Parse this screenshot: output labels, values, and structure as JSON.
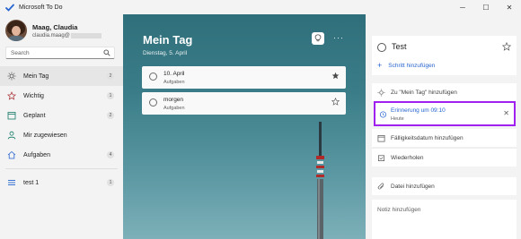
{
  "app": {
    "title": "Microsoft To Do"
  },
  "window_controls": {
    "minimize": "─",
    "maximize": "☐",
    "close": "✕"
  },
  "profile": {
    "name": "Maag, Claudia",
    "email": "claudia.maag@"
  },
  "search": {
    "placeholder": "Search"
  },
  "nav": [
    {
      "label": "Mein Tag",
      "count": "2",
      "icon": "sun-icon",
      "active": true
    },
    {
      "label": "Wichtig",
      "count": "1",
      "icon": "star-icon"
    },
    {
      "label": "Geplant",
      "count": "2",
      "icon": "calendar-icon"
    },
    {
      "label": "Mir zugewiesen",
      "count": "",
      "icon": "person-icon"
    },
    {
      "label": "Aufgaben",
      "count": "4",
      "icon": "home-icon"
    }
  ],
  "lists": [
    {
      "label": "test 1",
      "count": "1",
      "icon": "list-icon"
    }
  ],
  "main": {
    "title": "Mein Tag",
    "date": "Dienstag, 5. April",
    "more": "···",
    "tasks": [
      {
        "name": "10. April",
        "sub": "Aufgaben",
        "starred": true
      },
      {
        "name": "morgen",
        "sub": "Aufgaben",
        "starred": false
      }
    ]
  },
  "detail": {
    "task_title": "Test",
    "add_step": "Schritt hinzufügen",
    "add_my_day": "Zu \"Mein Tag\" hinzufügen",
    "reminder": {
      "title": "Erinnerung um 09:10",
      "sub": "Heute",
      "close": "✕"
    },
    "due_date": "Fälligkeitsdatum hinzufügen",
    "repeat": "Wiederholen",
    "add_file": "Datei hinzufügen",
    "note_placeholder": "Notiz hinzufügen"
  },
  "colors": {
    "accent": "#2564cf",
    "highlight_border": "#a020f0",
    "sidebar_bg": "#f3f3f3"
  }
}
